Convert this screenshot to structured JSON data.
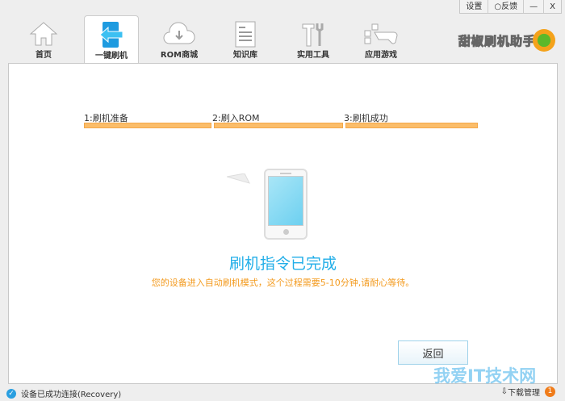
{
  "window": {
    "settings": "设置",
    "feedback": "反馈",
    "minimize": "—",
    "close": "X"
  },
  "tabs": [
    {
      "label": "首页"
    },
    {
      "label": "一键刷机"
    },
    {
      "label": "ROM商城"
    },
    {
      "label": "知识库"
    },
    {
      "label": "实用工具"
    },
    {
      "label": "应用游戏"
    }
  ],
  "logo": "甜椒刷机助手",
  "steps": [
    {
      "label": "1:刷机准备"
    },
    {
      "label": "2:刷入ROM"
    },
    {
      "label": "3:刷机成功"
    }
  ],
  "progress": {
    "completed_steps": 3,
    "total_steps": 3
  },
  "main": {
    "title": "刷机指令已完成",
    "subtitle": "您的设备进入自动刷机模式，这个过程需要5-10分钟,请耐心等待。",
    "back_button": "返回"
  },
  "status": {
    "text": "设备已成功连接(Recovery)",
    "download_label": "下载管理",
    "download_count": "1"
  },
  "watermark": "我爱IT技术网",
  "colors": {
    "accent": "#22aee8",
    "orange": "#f39a1d",
    "bar": "#fbbd6a"
  }
}
